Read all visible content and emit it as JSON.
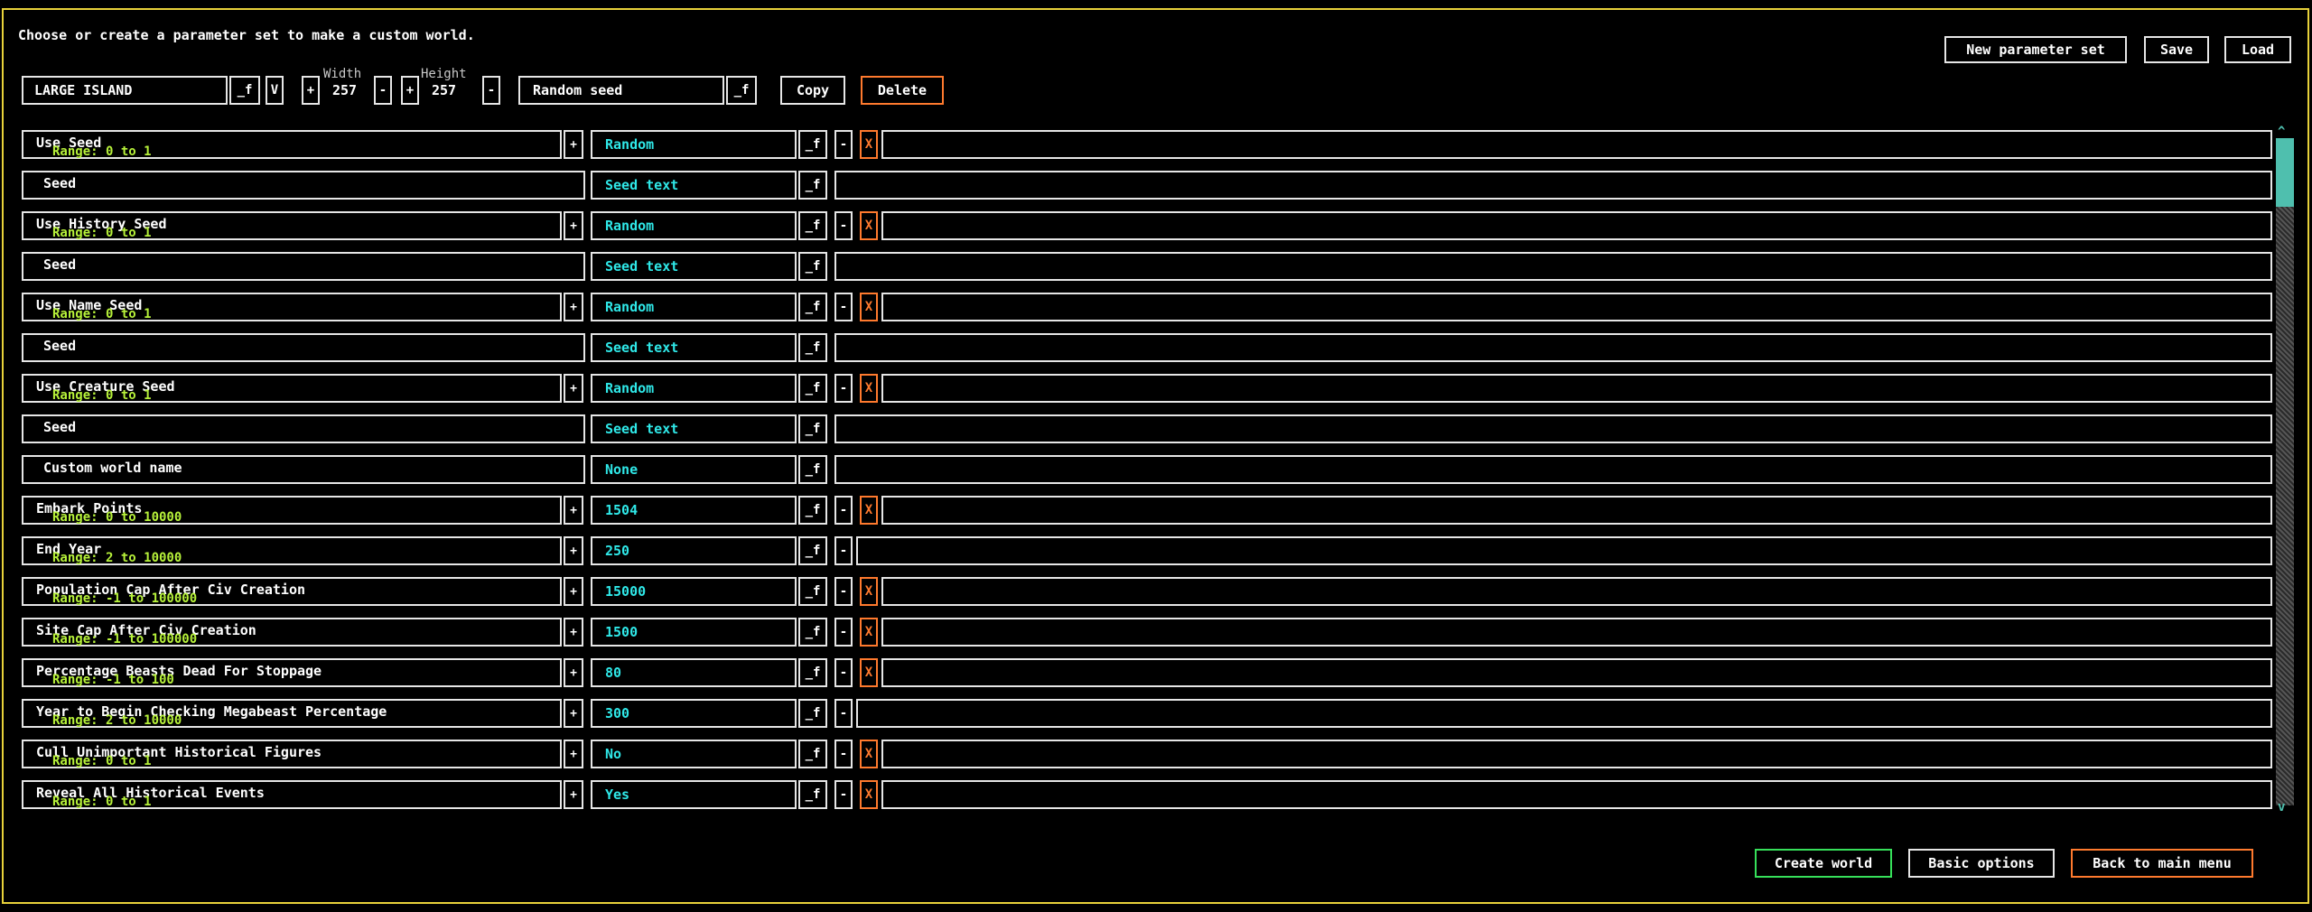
{
  "instruction": "Choose or create a parameter set to make a custom world.",
  "top_buttons": {
    "new_param_set": "New parameter set",
    "save": "Save",
    "load": "Load"
  },
  "preset": {
    "name": "LARGE ISLAND",
    "edit_icon": "_f",
    "dropdown_label": "V",
    "width_label": "Width",
    "width_value": "257",
    "height_label": "Height",
    "height_value": "257",
    "plus": "+",
    "minus": "-",
    "seed_value": "Random seed",
    "copy": "Copy",
    "delete": "Delete"
  },
  "icons": {
    "edit": "_f",
    "plus": "+",
    "minus": "-",
    "remove": "X"
  },
  "rows": [
    {
      "name": "Use Seed",
      "range": "Range: 0 to 1",
      "value": "Random"
    },
    {
      "name": "Seed",
      "range": "",
      "value": "Seed text"
    },
    {
      "name": "Use History Seed",
      "range": "Range: 0 to 1",
      "value": "Random"
    },
    {
      "name": "Seed",
      "range": "",
      "value": "Seed text"
    },
    {
      "name": "Use Name Seed",
      "range": "Range: 0 to 1",
      "value": "Random"
    },
    {
      "name": "Seed",
      "range": "",
      "value": "Seed text"
    },
    {
      "name": "Use Creature Seed",
      "range": "Range: 0 to 1",
      "value": "Random"
    },
    {
      "name": "Seed",
      "range": "",
      "value": "Seed text"
    },
    {
      "name": "Custom world name",
      "range": "",
      "value": "None"
    },
    {
      "name": "Embark Points",
      "range": "Range: 0 to 10000",
      "value": "1504"
    },
    {
      "name": "End Year",
      "range": "Range: 2 to 10000",
      "value": "250"
    },
    {
      "name": "Population Cap After Civ Creation",
      "range": "Range: -1 to 100000",
      "value": "15000"
    },
    {
      "name": "Site Cap After Civ Creation",
      "range": "Range: -1 to 100000",
      "value": "1500"
    },
    {
      "name": "Percentage Beasts Dead For Stoppage",
      "range": "Range: -1 to 100",
      "value": "80"
    },
    {
      "name": "Year to Begin Checking Megabeast Percentage",
      "range": "Range: 2 to 10000",
      "value": "300"
    },
    {
      "name": "Cull Unimportant Historical Figures",
      "range": "Range: 0 to 1",
      "value": "No"
    },
    {
      "name": "Reveal All Historical Events",
      "range": "Range: 0 to 1",
      "value": "Yes"
    }
  ],
  "bottom_buttons": {
    "create_world": "Create world",
    "basic_options": "Basic options",
    "back": "Back to main menu"
  },
  "colors": {
    "frame": "#e8d23a",
    "value_text": "#2fe8e8",
    "range_text": "#b7f23a",
    "remove": "#ff7a2e",
    "create": "#36e05a"
  }
}
